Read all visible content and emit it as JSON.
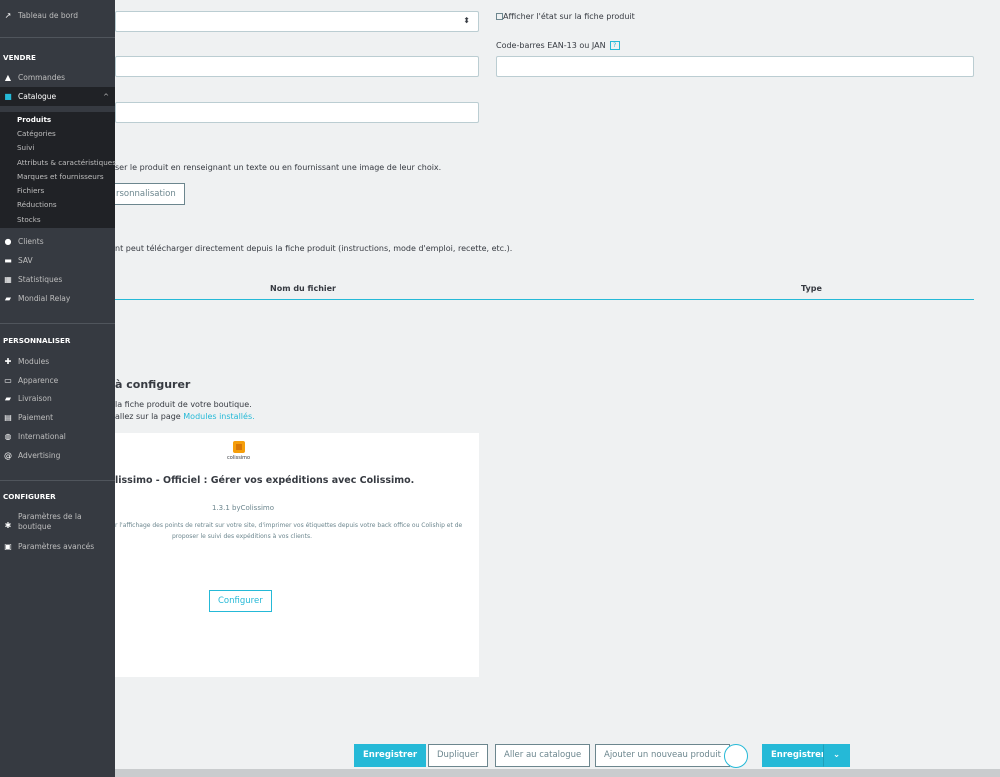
{
  "form": {
    "show_condition_label": "Afficher l'état sur la fiche produit",
    "barcode_label": "Code-barres EAN-13 ou JAN",
    "help_badge": "?",
    "customization_text": "ser le produit en renseignant un texte ou en fournissant une image de leur choix.",
    "customization_button": "rsonnalisation",
    "attachments_text": "nt peut télécharger directement depuis la fiche produit (instructions, mode d'emploi, recette, etc.).",
    "col_filename": "Nom du fichier",
    "col_type": "Type",
    "modules_title": "à configurer",
    "modules_line1": "la fiche produit de votre boutique.",
    "modules_line2_prefix": "allez sur la page ",
    "modules_line2_link": "Modules installés."
  },
  "module_card": {
    "logo_text": "colissimo",
    "title": "lissimo - Officiel : Gérer vos expéditions avec Colissimo.",
    "version": "1.3.1 byColissimo",
    "desc_line1": "r l'affichage des points de retrait sur votre site, d'imprimer vos étiquettes depuis votre back office ou Coliship et de",
    "desc_line2": "proposer le suivi des expéditions à vos clients.",
    "configure_button": "Configurer"
  },
  "bottom_bar": {
    "save": "Enregistrer",
    "duplicate": "Dupliquer",
    "catalog": "Aller au catalogue",
    "new_product": "Ajouter un nouveau produit",
    "save2": "Enregistrer"
  },
  "sidebar": {
    "dashboard": "Tableau de bord",
    "sell_head": "VENDRE",
    "orders": "Commandes",
    "catalog": "Catalogue",
    "catalog_sub": [
      "Produits",
      "Catégories",
      "Suivi",
      "Attributs & caractéristiques",
      "Marques et fournisseurs",
      "Fichiers",
      "Réductions",
      "Stocks"
    ],
    "customers": "Clients",
    "sav": "SAV",
    "stats": "Statistiques",
    "mondial": "Mondial Relay",
    "custom_head": "PERSONNALISER",
    "modules": "Modules",
    "appearance": "Apparence",
    "shipping": "Livraison",
    "payment": "Paiement",
    "international": "International",
    "advertising": "Advertising",
    "config_head": "CONFIGURER",
    "shop_params_1": "Paramètres de la",
    "shop_params_2": "boutique",
    "advanced": "Paramètres avancés"
  },
  "colors": {
    "accent": "#25b9d7",
    "sidebar_bg": "#363a41",
    "sidebar_active": "#202226"
  }
}
